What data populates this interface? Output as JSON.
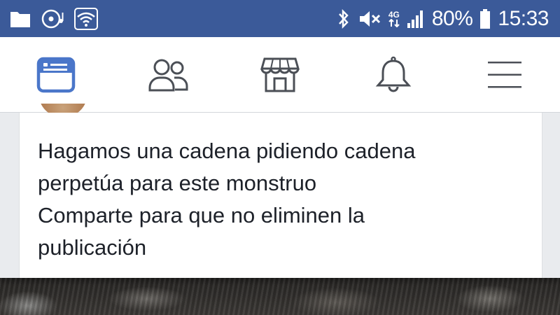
{
  "status_bar": {
    "icons": [
      "folder-icon",
      "media-icon",
      "wifi-icon",
      "bluetooth-icon",
      "mute-icon",
      "network-4g-icon",
      "signal-icon",
      "battery-icon"
    ],
    "network_label": "4G",
    "battery_percent": "80%",
    "time": "15:33",
    "background_color": "#3b5a99"
  },
  "nav_bar": {
    "items": [
      {
        "icon": "news-feed-icon",
        "active": true
      },
      {
        "icon": "friends-icon",
        "active": false
      },
      {
        "icon": "marketplace-icon",
        "active": false
      },
      {
        "icon": "notifications-icon",
        "active": false
      },
      {
        "icon": "menu-icon",
        "active": false
      }
    ],
    "active_color": "#4a76c9",
    "inactive_color": "#4b4f56"
  },
  "post": {
    "lines": [
      "Hagamos una cadena pidiendo cadena",
      "perpetúa para este monstruo",
      "Comparte para que no eliminen la",
      "publicación"
    ]
  }
}
